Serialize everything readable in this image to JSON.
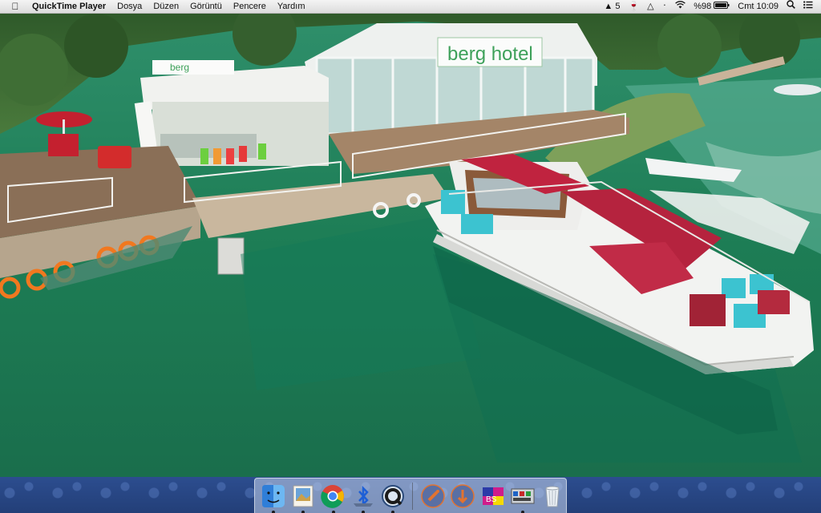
{
  "menubar": {
    "app_name": "QuickTime Player",
    "menus": [
      "Dosya",
      "Düzen",
      "Görüntü",
      "Pencere",
      "Yardım"
    ],
    "status": {
      "adobe_badge": "5",
      "battery": "%98",
      "clock": "Cmt 10:09"
    },
    "icons": [
      "apple-icon",
      "adobe-icon",
      "wine-glass-icon",
      "drive-icon",
      "bluetooth-icon",
      "wifi-icon",
      "battery-icon",
      "search-icon",
      "list-icon"
    ]
  },
  "scene": {
    "sign_main": "berg hotel",
    "sign_small": "berg"
  },
  "dock": {
    "apps": [
      "finder",
      "preview",
      "chrome",
      "bluetooth",
      "quicktime",
      "rocket-1",
      "rocket-2",
      "word",
      "system-prefs",
      "trash"
    ]
  }
}
